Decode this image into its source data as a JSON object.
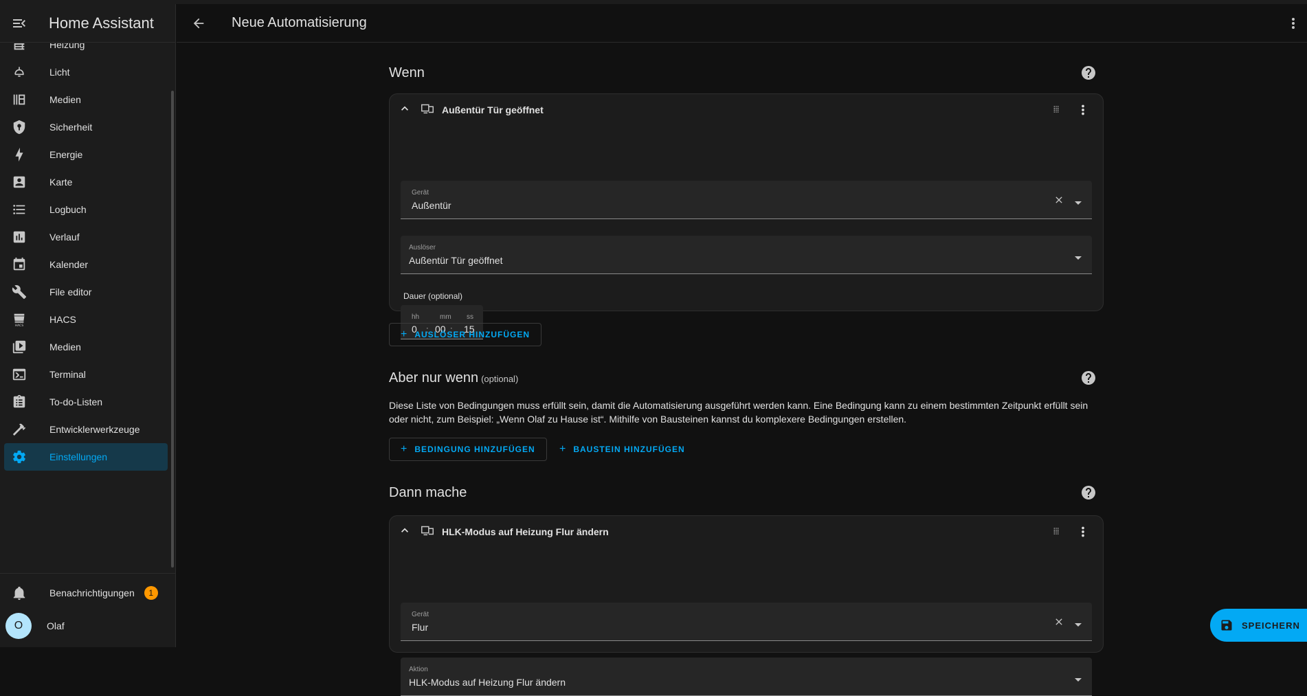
{
  "app": {
    "title": "Home Assistant"
  },
  "sidebar": {
    "items": [
      {
        "label": "Heizung",
        "icon": "heating-icon"
      },
      {
        "label": "Licht",
        "icon": "light-icon"
      },
      {
        "label": "Medien",
        "icon": "media-library-icon"
      },
      {
        "label": "Sicherheit",
        "icon": "shield-icon"
      },
      {
        "label": "Energie",
        "icon": "lightning-icon"
      },
      {
        "label": "Karte",
        "icon": "map-icon"
      },
      {
        "label": "Logbuch",
        "icon": "list-icon"
      },
      {
        "label": "Verlauf",
        "icon": "chart-icon"
      },
      {
        "label": "Kalender",
        "icon": "calendar-icon"
      },
      {
        "label": "File editor",
        "icon": "wrench-icon"
      },
      {
        "label": "HACS",
        "icon": "hacs-icon"
      },
      {
        "label": "Medien",
        "icon": "play-box-icon"
      },
      {
        "label": "Terminal",
        "icon": "terminal-icon"
      },
      {
        "label": "To-do-Listen",
        "icon": "clipboard-icon"
      },
      {
        "label": "Entwicklerwerkzeuge",
        "icon": "hammer-icon"
      },
      {
        "label": "Einstellungen",
        "icon": "gear-icon",
        "active": true
      }
    ],
    "notifications": {
      "label": "Benachrichtigungen",
      "count": "1"
    },
    "user": {
      "name": "Olaf",
      "initial": "O"
    }
  },
  "appbar": {
    "title": "Neue Automatisierung"
  },
  "when": {
    "title": "Wenn",
    "trigger": {
      "title": "Außentür Tür geöffnet",
      "device_label": "Gerät",
      "device_value": "Außentür",
      "trigger_label": "Auslöser",
      "trigger_value": "Außentür Tür geöffnet",
      "duration_label": "Dauer (optional)",
      "duration": {
        "hh_label": "hh",
        "mm_label": "mm",
        "ss_label": "ss",
        "hh": "0",
        "mm": "00",
        "ss": "15"
      }
    },
    "add_trigger": "AUSLÖSER HINZUFÜGEN"
  },
  "conditions": {
    "title": "Aber nur wenn",
    "optional": "(optional)",
    "description": "Diese Liste von Bedingungen muss erfüllt sein, damit die Automatisierung ausgeführt werden kann. Eine Bedingung kann zu einem bestimmten Zeitpunkt erfüllt sein oder nicht, zum Beispiel: „Wenn Olaf zu Hause ist“. Mithilfe von Bausteinen kannst du komplexere Bedingungen erstellen.",
    "add_condition": "BEDINGUNG HINZUFÜGEN",
    "add_block": "BAUSTEIN HINZUFÜGEN"
  },
  "then": {
    "title": "Dann mache",
    "action": {
      "title": "HLK-Modus auf Heizung Flur ändern",
      "device_label": "Gerät",
      "device_value": "Flur",
      "action_label": "Aktion",
      "action_value": "HLK-Modus auf Heizung Flur ändern"
    }
  },
  "save_button": "SPEICHERN",
  "colors": {
    "accent": "#03a9f4",
    "background": "#111111",
    "card": "#1c1c1c",
    "badge": "#ff9800"
  }
}
